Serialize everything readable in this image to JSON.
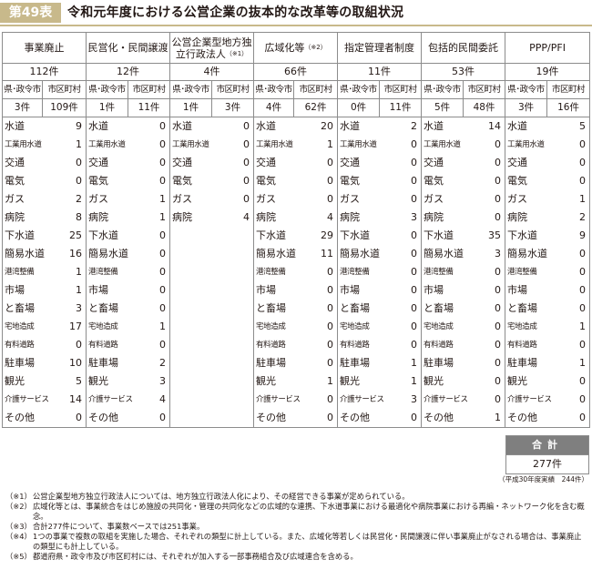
{
  "header": {
    "badge": "第49表",
    "title": "令和元年度における公営企業の抜本的な改革等の取組状況"
  },
  "columns": [
    {
      "label": "事業廃止",
      "note": "",
      "total": "112件",
      "pref_label": "県･政令市",
      "city_label": "市区町村",
      "pref": "3件",
      "city": "109件",
      "items": [
        [
          "水道",
          "9"
        ],
        [
          "工業用水道",
          "1"
        ],
        [
          "交通",
          "0"
        ],
        [
          "電気",
          "0"
        ],
        [
          "ガス",
          "2"
        ],
        [
          "病院",
          "8"
        ],
        [
          "下水道",
          "25"
        ],
        [
          "簡易水道",
          "16"
        ],
        [
          "港湾整備",
          "1"
        ],
        [
          "市場",
          "1"
        ],
        [
          "と畜場",
          "3"
        ],
        [
          "宅地造成",
          "17"
        ],
        [
          "有料道路",
          "0"
        ],
        [
          "駐車場",
          "10"
        ],
        [
          "観光",
          "5"
        ],
        [
          "介護サービス",
          "14"
        ],
        [
          "その他",
          "0"
        ]
      ]
    },
    {
      "label": "民営化・民間譲渡",
      "note": "",
      "total": "12件",
      "pref_label": "県･政令市",
      "city_label": "市区町村",
      "pref": "1件",
      "city": "11件",
      "items": [
        [
          "水道",
          "0"
        ],
        [
          "工業用水道",
          "0"
        ],
        [
          "交通",
          "0"
        ],
        [
          "電気",
          "0"
        ],
        [
          "ガス",
          "1"
        ],
        [
          "病院",
          "1"
        ],
        [
          "下水道",
          "0"
        ],
        [
          "簡易水道",
          "0"
        ],
        [
          "港湾整備",
          "0"
        ],
        [
          "市場",
          "0"
        ],
        [
          "と畜場",
          "0"
        ],
        [
          "宅地造成",
          "1"
        ],
        [
          "有料道路",
          "0"
        ],
        [
          "駐車場",
          "2"
        ],
        [
          "観光",
          "3"
        ],
        [
          "介護サービス",
          "4"
        ],
        [
          "その他",
          "0"
        ]
      ]
    },
    {
      "label": "公営企業型地方独立行政法人",
      "note": "（※1）",
      "total": "4件",
      "pref_label": "県･政令市",
      "city_label": "市区町村",
      "pref": "1件",
      "city": "3件",
      "items": [
        [
          "水道",
          "0"
        ],
        [
          "工業用水道",
          "0"
        ],
        [
          "交通",
          "0"
        ],
        [
          "電気",
          "0"
        ],
        [
          "ガス",
          "0"
        ],
        [
          "病院",
          "4"
        ]
      ]
    },
    {
      "label": "広域化等",
      "note": "（※2）",
      "total": "66件",
      "pref_label": "県･政令市",
      "city_label": "市区町村",
      "pref": "4件",
      "city": "62件",
      "items": [
        [
          "水道",
          "20"
        ],
        [
          "工業用水道",
          "1"
        ],
        [
          "交通",
          "0"
        ],
        [
          "電気",
          "0"
        ],
        [
          "ガス",
          "0"
        ],
        [
          "病院",
          "4"
        ],
        [
          "下水道",
          "29"
        ],
        [
          "簡易水道",
          "11"
        ],
        [
          "港湾整備",
          "0"
        ],
        [
          "市場",
          "0"
        ],
        [
          "と畜場",
          "0"
        ],
        [
          "宅地造成",
          "0"
        ],
        [
          "有料道路",
          "0"
        ],
        [
          "駐車場",
          "0"
        ],
        [
          "観光",
          "1"
        ],
        [
          "介護サービス",
          "0"
        ],
        [
          "その他",
          "0"
        ]
      ]
    },
    {
      "label": "指定管理者制度",
      "note": "",
      "total": "11件",
      "pref_label": "県･政令市",
      "city_label": "市区町村",
      "pref": "0件",
      "city": "11件",
      "items": [
        [
          "水道",
          "2"
        ],
        [
          "工業用水道",
          "0"
        ],
        [
          "交通",
          "0"
        ],
        [
          "電気",
          "0"
        ],
        [
          "ガス",
          "0"
        ],
        [
          "病院",
          "3"
        ],
        [
          "下水道",
          "0"
        ],
        [
          "簡易水道",
          "0"
        ],
        [
          "港湾整備",
          "0"
        ],
        [
          "市場",
          "0"
        ],
        [
          "と畜場",
          "0"
        ],
        [
          "宅地造成",
          "0"
        ],
        [
          "有料道路",
          "0"
        ],
        [
          "駐車場",
          "1"
        ],
        [
          "観光",
          "1"
        ],
        [
          "介護サービス",
          "3"
        ],
        [
          "その他",
          "0"
        ]
      ]
    },
    {
      "label": "包括的民間委託",
      "note": "",
      "total": "53件",
      "pref_label": "県･政令市",
      "city_label": "市区町村",
      "pref": "5件",
      "city": "48件",
      "items": [
        [
          "水道",
          "14"
        ],
        [
          "工業用水道",
          "0"
        ],
        [
          "交通",
          "0"
        ],
        [
          "電気",
          "0"
        ],
        [
          "ガス",
          "0"
        ],
        [
          "病院",
          "0"
        ],
        [
          "下水道",
          "35"
        ],
        [
          "簡易水道",
          "3"
        ],
        [
          "港湾整備",
          "0"
        ],
        [
          "市場",
          "0"
        ],
        [
          "と畜場",
          "0"
        ],
        [
          "宅地造成",
          "0"
        ],
        [
          "有料道路",
          "0"
        ],
        [
          "駐車場",
          "0"
        ],
        [
          "観光",
          "0"
        ],
        [
          "介護サービス",
          "0"
        ],
        [
          "その他",
          "1"
        ]
      ]
    },
    {
      "label": "PPP/PFI",
      "note": "",
      "total": "19件",
      "pref_label": "県･政令市",
      "city_label": "市区町村",
      "pref": "3件",
      "city": "16件",
      "items": [
        [
          "水道",
          "5"
        ],
        [
          "工業用水道",
          "0"
        ],
        [
          "交通",
          "0"
        ],
        [
          "電気",
          "0"
        ],
        [
          "ガス",
          "1"
        ],
        [
          "病院",
          "2"
        ],
        [
          "下水道",
          "9"
        ],
        [
          "簡易水道",
          "0"
        ],
        [
          "港湾整備",
          "0"
        ],
        [
          "市場",
          "0"
        ],
        [
          "と畜場",
          "0"
        ],
        [
          "宅地造成",
          "1"
        ],
        [
          "有料道路",
          "0"
        ],
        [
          "駐車場",
          "1"
        ],
        [
          "観光",
          "0"
        ],
        [
          "介護サービス",
          "0"
        ],
        [
          "その他",
          "0"
        ]
      ]
    }
  ],
  "summary": {
    "label": "合計",
    "value": "277件",
    "note": "（平成30年度実績　244件）"
  },
  "notes": [
    {
      "k": "（※1）",
      "t": "公営企業型地方独立行政法人については、地方独立行政法人化により、その経営できる事業が定められている。"
    },
    {
      "k": "（※2）",
      "t": "広域化等とは、事業統合をはじめ施設の共同化・管理の共同化などの広域的な連携、下水道事業における最適化や病院事業における再編・ネットワーク化を含む概念。"
    },
    {
      "k": "（※3）",
      "t": "合計277件について、事業数ベースでは251事業。"
    },
    {
      "k": "（※4）",
      "t": "1つの事業で複数の取組を実施した場合、それぞれの類型に計上している。また、広域化等若しくは民営化・民間譲渡に伴い事業廃止がなされる場合は、事業廃止の類型にも計上している。"
    },
    {
      "k": "（※5）",
      "t": "都道府県・政令市及び市区町村には、それぞれが加入する一部事務組合及び広域連合を含める。"
    }
  ]
}
